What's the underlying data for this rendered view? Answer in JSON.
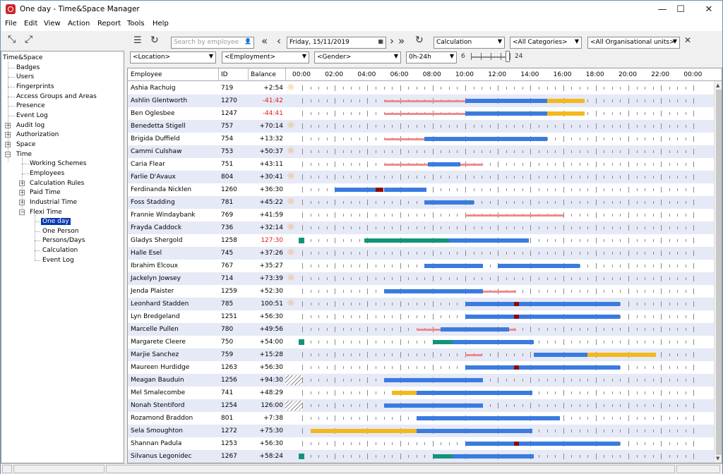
{
  "window": {
    "title": "One day - Time&Space Manager",
    "minimize": "—",
    "maximize": "☐",
    "close": "✕"
  },
  "menu": [
    "File",
    "Edit",
    "View",
    "Action",
    "Report",
    "Tools",
    "Help"
  ],
  "toolbar": {
    "search_placeholder": "Search by employee",
    "date": "Friday, 15/11/2019",
    "calculation": "Calculation",
    "categories": "<All Categories>",
    "org_units": "<All Organisational units>",
    "location": "<Location>",
    "employment": "<Employment>",
    "gender": "<Gender>",
    "hours_range": "0h-24h",
    "slider_min": "6",
    "slider_max": "24",
    "slider_value": 24
  },
  "tree": {
    "root": "Time&Space",
    "items": [
      "Badges",
      "Users",
      "Fingerprints",
      "Access Groups and Areas",
      "Presence",
      "Event Log",
      "Audit log",
      "Authorization",
      "Space",
      "Time"
    ],
    "time_children": [
      "Working Schemes",
      "Employees",
      "Calculation Rules",
      "Paid Time",
      "Industrial Time",
      "Flexi Time"
    ],
    "flexi_children": [
      "One day",
      "One Person",
      "Persons/Days",
      "Calculation",
      "Event Log"
    ],
    "selected": "One day"
  },
  "grid": {
    "columns": {
      "employee": "Employee",
      "id": "ID",
      "balance": "Balance"
    },
    "hours": [
      "00:00",
      "02:00",
      "04:00",
      "06:00",
      "08:00",
      "10:00",
      "12:00",
      "14:00",
      "16:00",
      "18:00",
      "20:00",
      "22:00",
      "00:00"
    ],
    "colors": {
      "pink": "#f08a8a",
      "blue": "#3a7be0",
      "yellow": "#f5b81c",
      "green": "#12937a",
      "darkred": "#8b0b0b"
    },
    "rows": [
      {
        "name": "Ashia Rachuig",
        "id": "719",
        "balance": "+2:54",
        "icon": "sun",
        "bars": []
      },
      {
        "name": "Ashlin Glentworth",
        "id": "1270",
        "balance": "-41:42",
        "neg": true,
        "bars": [
          [
            "pink",
            5,
            10,
            1
          ],
          [
            "blue",
            10,
            15,
            0
          ],
          [
            "yellow",
            15,
            17.3,
            0
          ]
        ]
      },
      {
        "name": "Ben Oglesbee",
        "id": "1247",
        "balance": "-44:41",
        "neg": true,
        "bars": [
          [
            "pink",
            5,
            10,
            1
          ],
          [
            "blue",
            10,
            15,
            0
          ],
          [
            "yellow",
            15,
            17.3,
            0
          ]
        ]
      },
      {
        "name": "Benedetta Stigell",
        "id": "757",
        "balance": "+70:14",
        "icon": "sun",
        "bars": []
      },
      {
        "name": "Brigida Duffield",
        "id": "754",
        "balance": "+13:32",
        "bars": [
          [
            "pink",
            5,
            7.5,
            1
          ],
          [
            "blue",
            7.5,
            15,
            0
          ]
        ]
      },
      {
        "name": "Cammi Culshaw",
        "id": "753",
        "balance": "+50:37",
        "icon": "sun",
        "bars": []
      },
      {
        "name": "Caria Flear",
        "id": "751",
        "balance": "+43:11",
        "bars": [
          [
            "pink",
            5,
            7.7,
            1
          ],
          [
            "blue",
            7.7,
            9.7,
            0
          ],
          [
            "pink",
            9.7,
            11.1,
            1
          ]
        ]
      },
      {
        "name": "Farlie D'Avaux",
        "id": "804",
        "balance": "+30:41",
        "icon": "sun",
        "bars": []
      },
      {
        "name": "Ferdinanda Nicklen",
        "id": "1260",
        "balance": "+36:30",
        "bars": [
          [
            "blue",
            2,
            4.5,
            0
          ],
          [
            "darkred",
            4.5,
            5,
            0
          ],
          [
            "blue",
            5,
            7.6,
            0
          ]
        ]
      },
      {
        "name": "Foss Stadding",
        "id": "781",
        "balance": "+45:22",
        "icon": "sun",
        "bars": [
          [
            "blue",
            7.5,
            10.5,
            0
          ]
        ]
      },
      {
        "name": "Frannie Windaybank",
        "id": "769",
        "balance": "+41:59",
        "bars": [
          [
            "pink",
            10,
            16,
            1
          ]
        ]
      },
      {
        "name": "Frayda Caddock",
        "id": "736",
        "balance": "+32:14",
        "icon": "sun",
        "bars": []
      },
      {
        "name": "Gladys Shergold",
        "id": "1258",
        "balance": "127:30",
        "neg": true,
        "green_start": true,
        "bars": [
          [
            "green",
            3.8,
            9,
            0
          ],
          [
            "blue",
            9,
            13.9,
            0
          ]
        ]
      },
      {
        "name": "Halle Esel",
        "id": "745",
        "balance": "+37:26",
        "icon": "sun",
        "bars": []
      },
      {
        "name": "Ibrahim Elcoux",
        "id": "767",
        "balance": "+35:27",
        "bars": [
          [
            "blue",
            7.5,
            11.1,
            0
          ],
          [
            "blue",
            12,
            17,
            0
          ]
        ]
      },
      {
        "name": "Jackelyn Jowsey",
        "id": "714",
        "balance": "+73:39",
        "icon": "sun",
        "bars": []
      },
      {
        "name": "Jenda Plaister",
        "id": "1259",
        "balance": "+52:30",
        "bars": [
          [
            "blue",
            5,
            11.1,
            0
          ],
          [
            "pink",
            11.1,
            13.1,
            1
          ]
        ]
      },
      {
        "name": "Leonhard Stadden",
        "id": "785",
        "balance": "100:51",
        "icon": "sun",
        "bars": [
          [
            "blue",
            10,
            13,
            0
          ],
          [
            "darkred",
            13,
            13.3,
            0
          ],
          [
            "blue",
            13.3,
            19.5,
            0
          ]
        ]
      },
      {
        "name": "Lyn Bredgeland",
        "id": "1251",
        "balance": "+56:30",
        "bars": [
          [
            "blue",
            10,
            13,
            0
          ],
          [
            "darkred",
            13,
            13.3,
            0
          ],
          [
            "blue",
            13.3,
            19.5,
            0
          ]
        ]
      },
      {
        "name": "Marcelle Pullen",
        "id": "780",
        "balance": "+49:56",
        "bars": [
          [
            "pink",
            7,
            8.5,
            1
          ],
          [
            "blue",
            8.5,
            12.7,
            0
          ],
          [
            "pink",
            12.7,
            13.1,
            1
          ]
        ]
      },
      {
        "name": "Margarete Cleere",
        "id": "750",
        "balance": "+54:00",
        "green_start": true,
        "bars": [
          [
            "green",
            8,
            9.2,
            0
          ],
          [
            "blue",
            9.2,
            14.2,
            0
          ]
        ]
      },
      {
        "name": "Marjie Sanchez",
        "id": "759",
        "balance": "+15:28",
        "bars": [
          [
            "pink",
            10,
            11,
            1
          ],
          [
            "blue",
            14.2,
            17.5,
            0
          ],
          [
            "yellow",
            17.5,
            21.7,
            0
          ]
        ]
      },
      {
        "name": "Maureen Hurdidge",
        "id": "1263",
        "balance": "+56:30",
        "bars": [
          [
            "blue",
            10,
            13,
            0
          ],
          [
            "darkred",
            13,
            13.3,
            0
          ],
          [
            "blue",
            13.3,
            19.5,
            0
          ]
        ]
      },
      {
        "name": "Meagan Bauduin",
        "id": "1256",
        "balance": "+94:30",
        "icon": "hatch",
        "bars": [
          [
            "blue",
            5,
            11.1,
            0
          ]
        ]
      },
      {
        "name": "Mel Smalecombe",
        "id": "741",
        "balance": "+48:29",
        "bars": [
          [
            "yellow",
            5.5,
            7,
            0
          ],
          [
            "blue",
            7,
            14.1,
            0
          ]
        ]
      },
      {
        "name": "Nonah Stentiford",
        "id": "1254",
        "balance": "126:00",
        "icon": "hatch",
        "bars": [
          [
            "blue",
            5,
            11.1,
            0
          ]
        ]
      },
      {
        "name": "Rozamond Braddon",
        "id": "801",
        "balance": "+7:38",
        "bars": [
          [
            "blue",
            7,
            15.8,
            0
          ]
        ]
      },
      {
        "name": "Sela Smoughton",
        "id": "1272",
        "balance": "+75:30",
        "bars": [
          [
            "yellow",
            0.5,
            7,
            0
          ],
          [
            "blue",
            7,
            14.1,
            0
          ]
        ]
      },
      {
        "name": "Shannan Padula",
        "id": "1253",
        "balance": "+56:30",
        "bars": [
          [
            "blue",
            10,
            13,
            0
          ],
          [
            "darkred",
            13,
            13.3,
            0
          ],
          [
            "blue",
            13.3,
            19.5,
            0
          ]
        ]
      },
      {
        "name": "Silvanus Legonidec",
        "id": "1267",
        "balance": "+58:24",
        "green_start": true,
        "bars": [
          [
            "green",
            8,
            9.2,
            0
          ],
          [
            "blue",
            9.2,
            14.2,
            0
          ]
        ]
      }
    ]
  }
}
